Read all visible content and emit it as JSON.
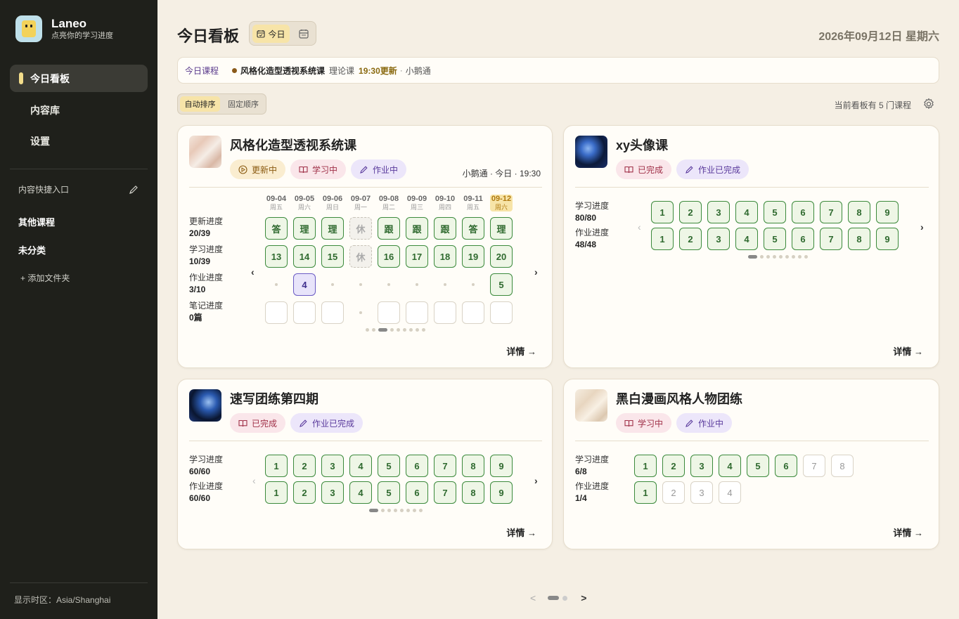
{
  "app": {
    "name": "Laneo",
    "tagline": "点亮你的学习进度"
  },
  "sidebar": {
    "nav": [
      {
        "label": "今日看板",
        "active": true
      },
      {
        "label": "内容库"
      },
      {
        "label": "设置"
      }
    ],
    "quick_entry_label": "内容快捷入口",
    "groups": [
      "其他课程",
      "未分类"
    ],
    "add_folder": "+ 添加文件夹",
    "timezone": "显示时区：Asia/Shanghai"
  },
  "header": {
    "title": "今日看板",
    "view_today": "今日",
    "date": "2026年09月12日 星期六"
  },
  "today_bar": {
    "label": "今日课程",
    "course": "风格化造型透视系统课",
    "type": "理论课",
    "time": "19:30更新",
    "separator": "·",
    "teacher": "小鹅通"
  },
  "sort": {
    "auto": "自动排序",
    "fixed": "固定顺序"
  },
  "board_count": "当前看板有 5 门课程",
  "detail_label": "详情 →",
  "cards": {
    "c1": {
      "title": "风格化造型透视系统课",
      "badges": [
        "更新中",
        "学习中",
        "作业中"
      ],
      "meta": "小鹅通 · 今日 · 19:30",
      "days": [
        {
          "d": "09-04",
          "w": "周五"
        },
        {
          "d": "09-05",
          "w": "周六"
        },
        {
          "d": "09-06",
          "w": "周日"
        },
        {
          "d": "09-07",
          "w": "周一"
        },
        {
          "d": "09-08",
          "w": "周二"
        },
        {
          "d": "09-09",
          "w": "周三"
        },
        {
          "d": "09-10",
          "w": "周四"
        },
        {
          "d": "09-11",
          "w": "周五"
        },
        {
          "d": "09-12",
          "w": "周六",
          "today": true
        }
      ],
      "rows": [
        {
          "label": "更新进度",
          "value": "20/39",
          "cells": [
            {
              "t": "答",
              "s": "g"
            },
            {
              "t": "理",
              "s": "g"
            },
            {
              "t": "理",
              "s": "g"
            },
            {
              "t": "休",
              "s": "rest"
            },
            {
              "t": "跟",
              "s": "g"
            },
            {
              "t": "跟",
              "s": "g"
            },
            {
              "t": "跟",
              "s": "g"
            },
            {
              "t": "答",
              "s": "g"
            },
            {
              "t": "理",
              "s": "g"
            }
          ]
        },
        {
          "label": "学习进度",
          "value": "10/39",
          "cells": [
            {
              "t": "13",
              "s": "g"
            },
            {
              "t": "14",
              "s": "g"
            },
            {
              "t": "15",
              "s": "g"
            },
            {
              "t": "休",
              "s": "rest"
            },
            {
              "t": "16",
              "s": "g"
            },
            {
              "t": "17",
              "s": "g"
            },
            {
              "t": "18",
              "s": "g"
            },
            {
              "t": "19",
              "s": "g"
            },
            {
              "t": "20",
              "s": "g"
            }
          ]
        },
        {
          "label": "作业进度",
          "value": "3/10",
          "cells": [
            {
              "s": "dot"
            },
            {
              "t": "4",
              "s": "hw"
            },
            {
              "s": "dot"
            },
            {
              "s": "dot"
            },
            {
              "s": "dot"
            },
            {
              "s": "dot"
            },
            {
              "s": "dot"
            },
            {
              "s": "dot"
            },
            {
              "t": "5",
              "s": "g"
            }
          ]
        },
        {
          "label": "笔记进度",
          "value": "0篇",
          "cells": [
            {
              "s": "empty"
            },
            {
              "s": "empty"
            },
            {
              "s": "empty"
            },
            {
              "s": "dot"
            },
            {
              "s": "empty"
            },
            {
              "s": "empty"
            },
            {
              "s": "empty"
            },
            {
              "s": "empty"
            },
            {
              "s": "empty"
            }
          ]
        }
      ],
      "page_count": 9,
      "page_active": 2
    },
    "c2": {
      "title": "xy头像课",
      "badges": [
        "已完成",
        "作业已完成"
      ],
      "rows": [
        {
          "label": "学习进度",
          "value": "80/80",
          "cells": [
            "1",
            "2",
            "3",
            "4",
            "5",
            "6",
            "7",
            "8",
            "9"
          ],
          "done": 9
        },
        {
          "label": "作业进度",
          "value": "48/48",
          "cells": [
            "1",
            "2",
            "3",
            "4",
            "5",
            "6",
            "7",
            "8",
            "9"
          ],
          "done": 9
        }
      ],
      "page_count": 9,
      "page_active": 0
    },
    "c3": {
      "title": "速写团练第四期",
      "badges": [
        "已完成",
        "作业已完成"
      ],
      "rows": [
        {
          "label": "学习进度",
          "value": "60/60",
          "cells": [
            "1",
            "2",
            "3",
            "4",
            "5",
            "6",
            "7",
            "8",
            "9"
          ],
          "done": 9
        },
        {
          "label": "作业进度",
          "value": "60/60",
          "cells": [
            "1",
            "2",
            "3",
            "4",
            "5",
            "6",
            "7",
            "8",
            "9"
          ],
          "done": 9
        }
      ],
      "page_count": 8,
      "page_active": 0
    },
    "c4": {
      "title": "黑白漫画风格人物团练",
      "badges": [
        "学习中",
        "作业中"
      ],
      "rows": [
        {
          "label": "学习进度",
          "value": "6/8",
          "cells": [
            "1",
            "2",
            "3",
            "4",
            "5",
            "6",
            "7",
            "8"
          ],
          "done": 6
        },
        {
          "label": "作业进度",
          "value": "1/4",
          "cells": [
            "1",
            "2",
            "3",
            "4"
          ],
          "done": 1
        }
      ]
    }
  },
  "pagination": {
    "prev": "<",
    "next": ">",
    "pages": 2,
    "active": 0
  }
}
